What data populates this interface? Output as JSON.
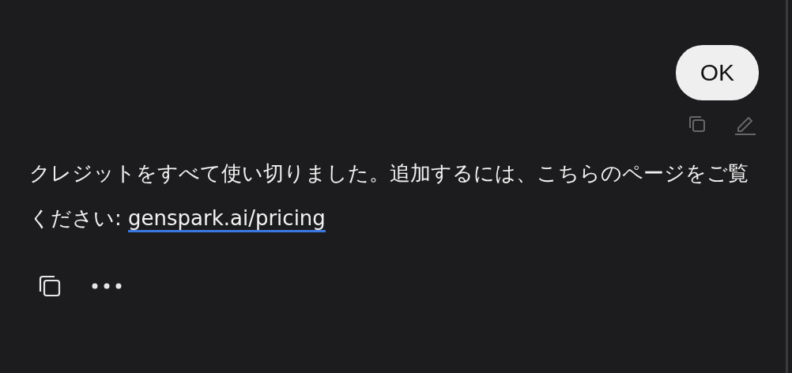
{
  "user_message": {
    "text": "OK"
  },
  "assistant_message": {
    "text": "クレジットをすべて使い切りました。追加するには、こちらのページをご覧ください: ",
    "link": "genspark.ai/pricing"
  }
}
